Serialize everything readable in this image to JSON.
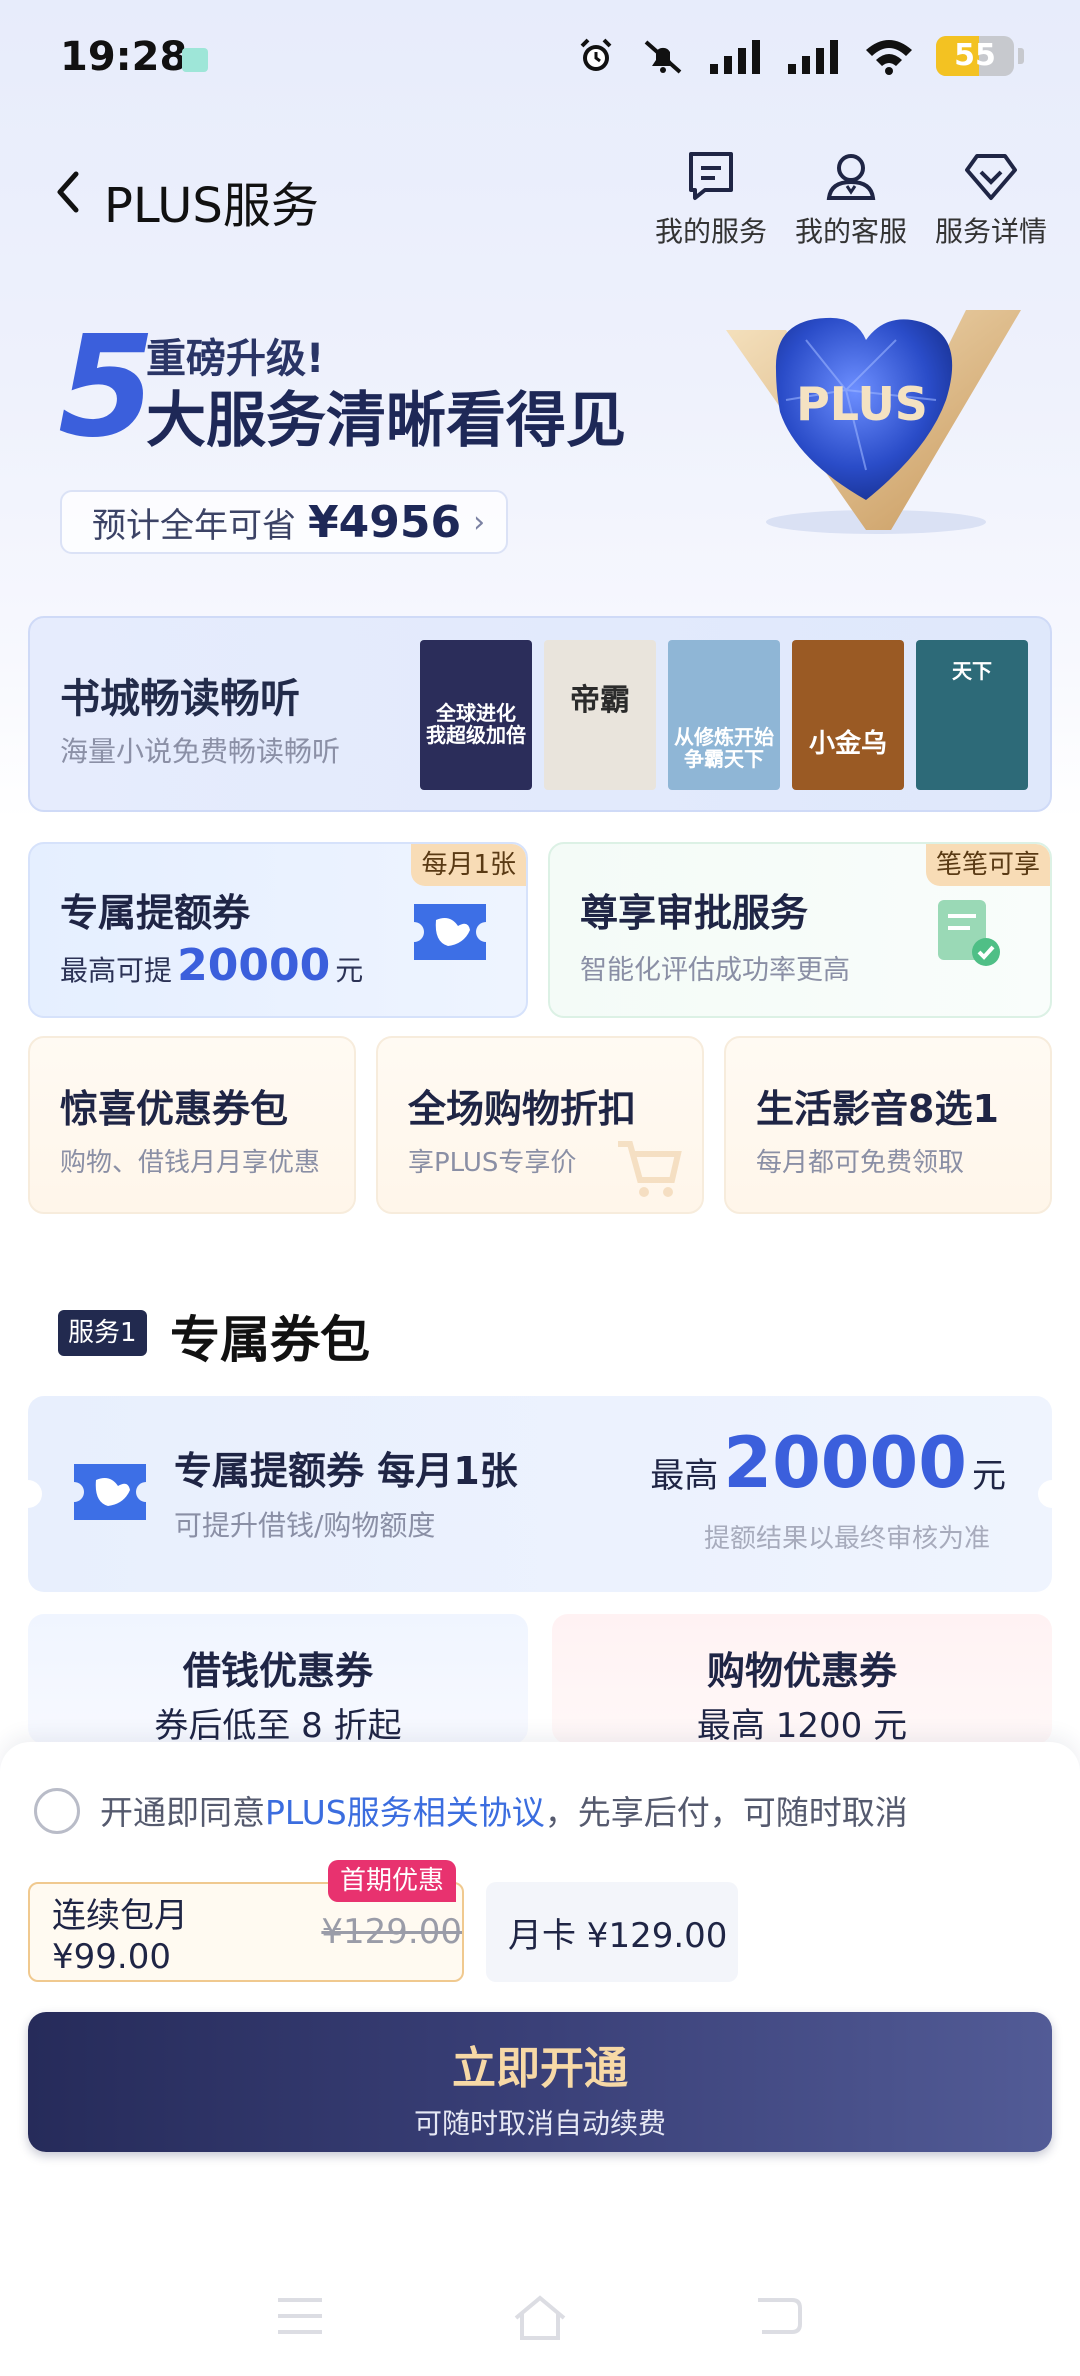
{
  "status_bar": {
    "time": "19:28",
    "battery": "55",
    "battery_level": 0.55
  },
  "header": {
    "title": "PLUS服务",
    "actions": [
      {
        "label": "我的服务",
        "icon": "document-icon"
      },
      {
        "label": "我的客服",
        "icon": "customer-service-icon"
      },
      {
        "label": "服务详情",
        "icon": "diamond-icon"
      }
    ]
  },
  "promo": {
    "number": "5",
    "line1": "重磅升级!",
    "line2": "大服务清晰看得见",
    "savings_label": "预计全年可省",
    "savings_amount": "¥4956",
    "badge_text": "PLUS"
  },
  "books": {
    "title": "书城畅读畅听",
    "subtitle": "海量小说免费畅读畅听",
    "covers": [
      {
        "title": "全球进化 我超级加倍",
        "color": "#2b2d5a"
      },
      {
        "title": "帝霸",
        "color": "#e9e4dc"
      },
      {
        "title": "从修炼开始 争霸天下",
        "color": "#8fb6d6"
      },
      {
        "title": "小金乌",
        "color": "#9a5a24"
      },
      {
        "title": "天下",
        "color": "#2d6a78"
      }
    ]
  },
  "benefits": {
    "quota": {
      "title": "专属提额券",
      "prefix": "最高可提",
      "amount": "20000",
      "unit": "元",
      "tag": "每月1张"
    },
    "approval": {
      "title": "尊享审批服务",
      "sub": "智能化评估成功率更高",
      "tag": "笔笔可享"
    },
    "small": [
      {
        "title": "惊喜优惠券包",
        "sub": "购物、借钱月月享优惠"
      },
      {
        "title": "全场购物折扣",
        "sub": "享PLUS专享价"
      },
      {
        "title": "生活影音8选1",
        "sub": "每月都可免费领取"
      }
    ]
  },
  "section": {
    "badge": "服务1",
    "title": "专属券包",
    "coupon": {
      "title": "专属提额券 每月1张",
      "sub": "可提升借钱/购物额度",
      "prefix": "最高",
      "amount": "20000",
      "unit": "元",
      "note": "提额结果以最终审核为准"
    },
    "vouchers": [
      {
        "title": "借钱优惠券",
        "sub": "券后低至 8 折起"
      },
      {
        "title": "购物优惠券",
        "sub": "最高 1200 元"
      }
    ]
  },
  "agreement": {
    "prefix": "开通即同意",
    "link": "PLUS服务相关协议",
    "suffix": "，先享后付，可随时取消"
  },
  "plans": {
    "selected": {
      "label": "连续包月 ¥99.00",
      "original": "¥129.00",
      "badge": "首期优惠"
    },
    "other": {
      "label": "月卡 ¥129.00"
    }
  },
  "cta": {
    "main": "立即开通",
    "sub": "可随时取消自动续费"
  },
  "colors": {
    "accent": "#3b5fdc",
    "cta_gold": "#f7d9a6",
    "badge_pink": "#e8326f"
  }
}
